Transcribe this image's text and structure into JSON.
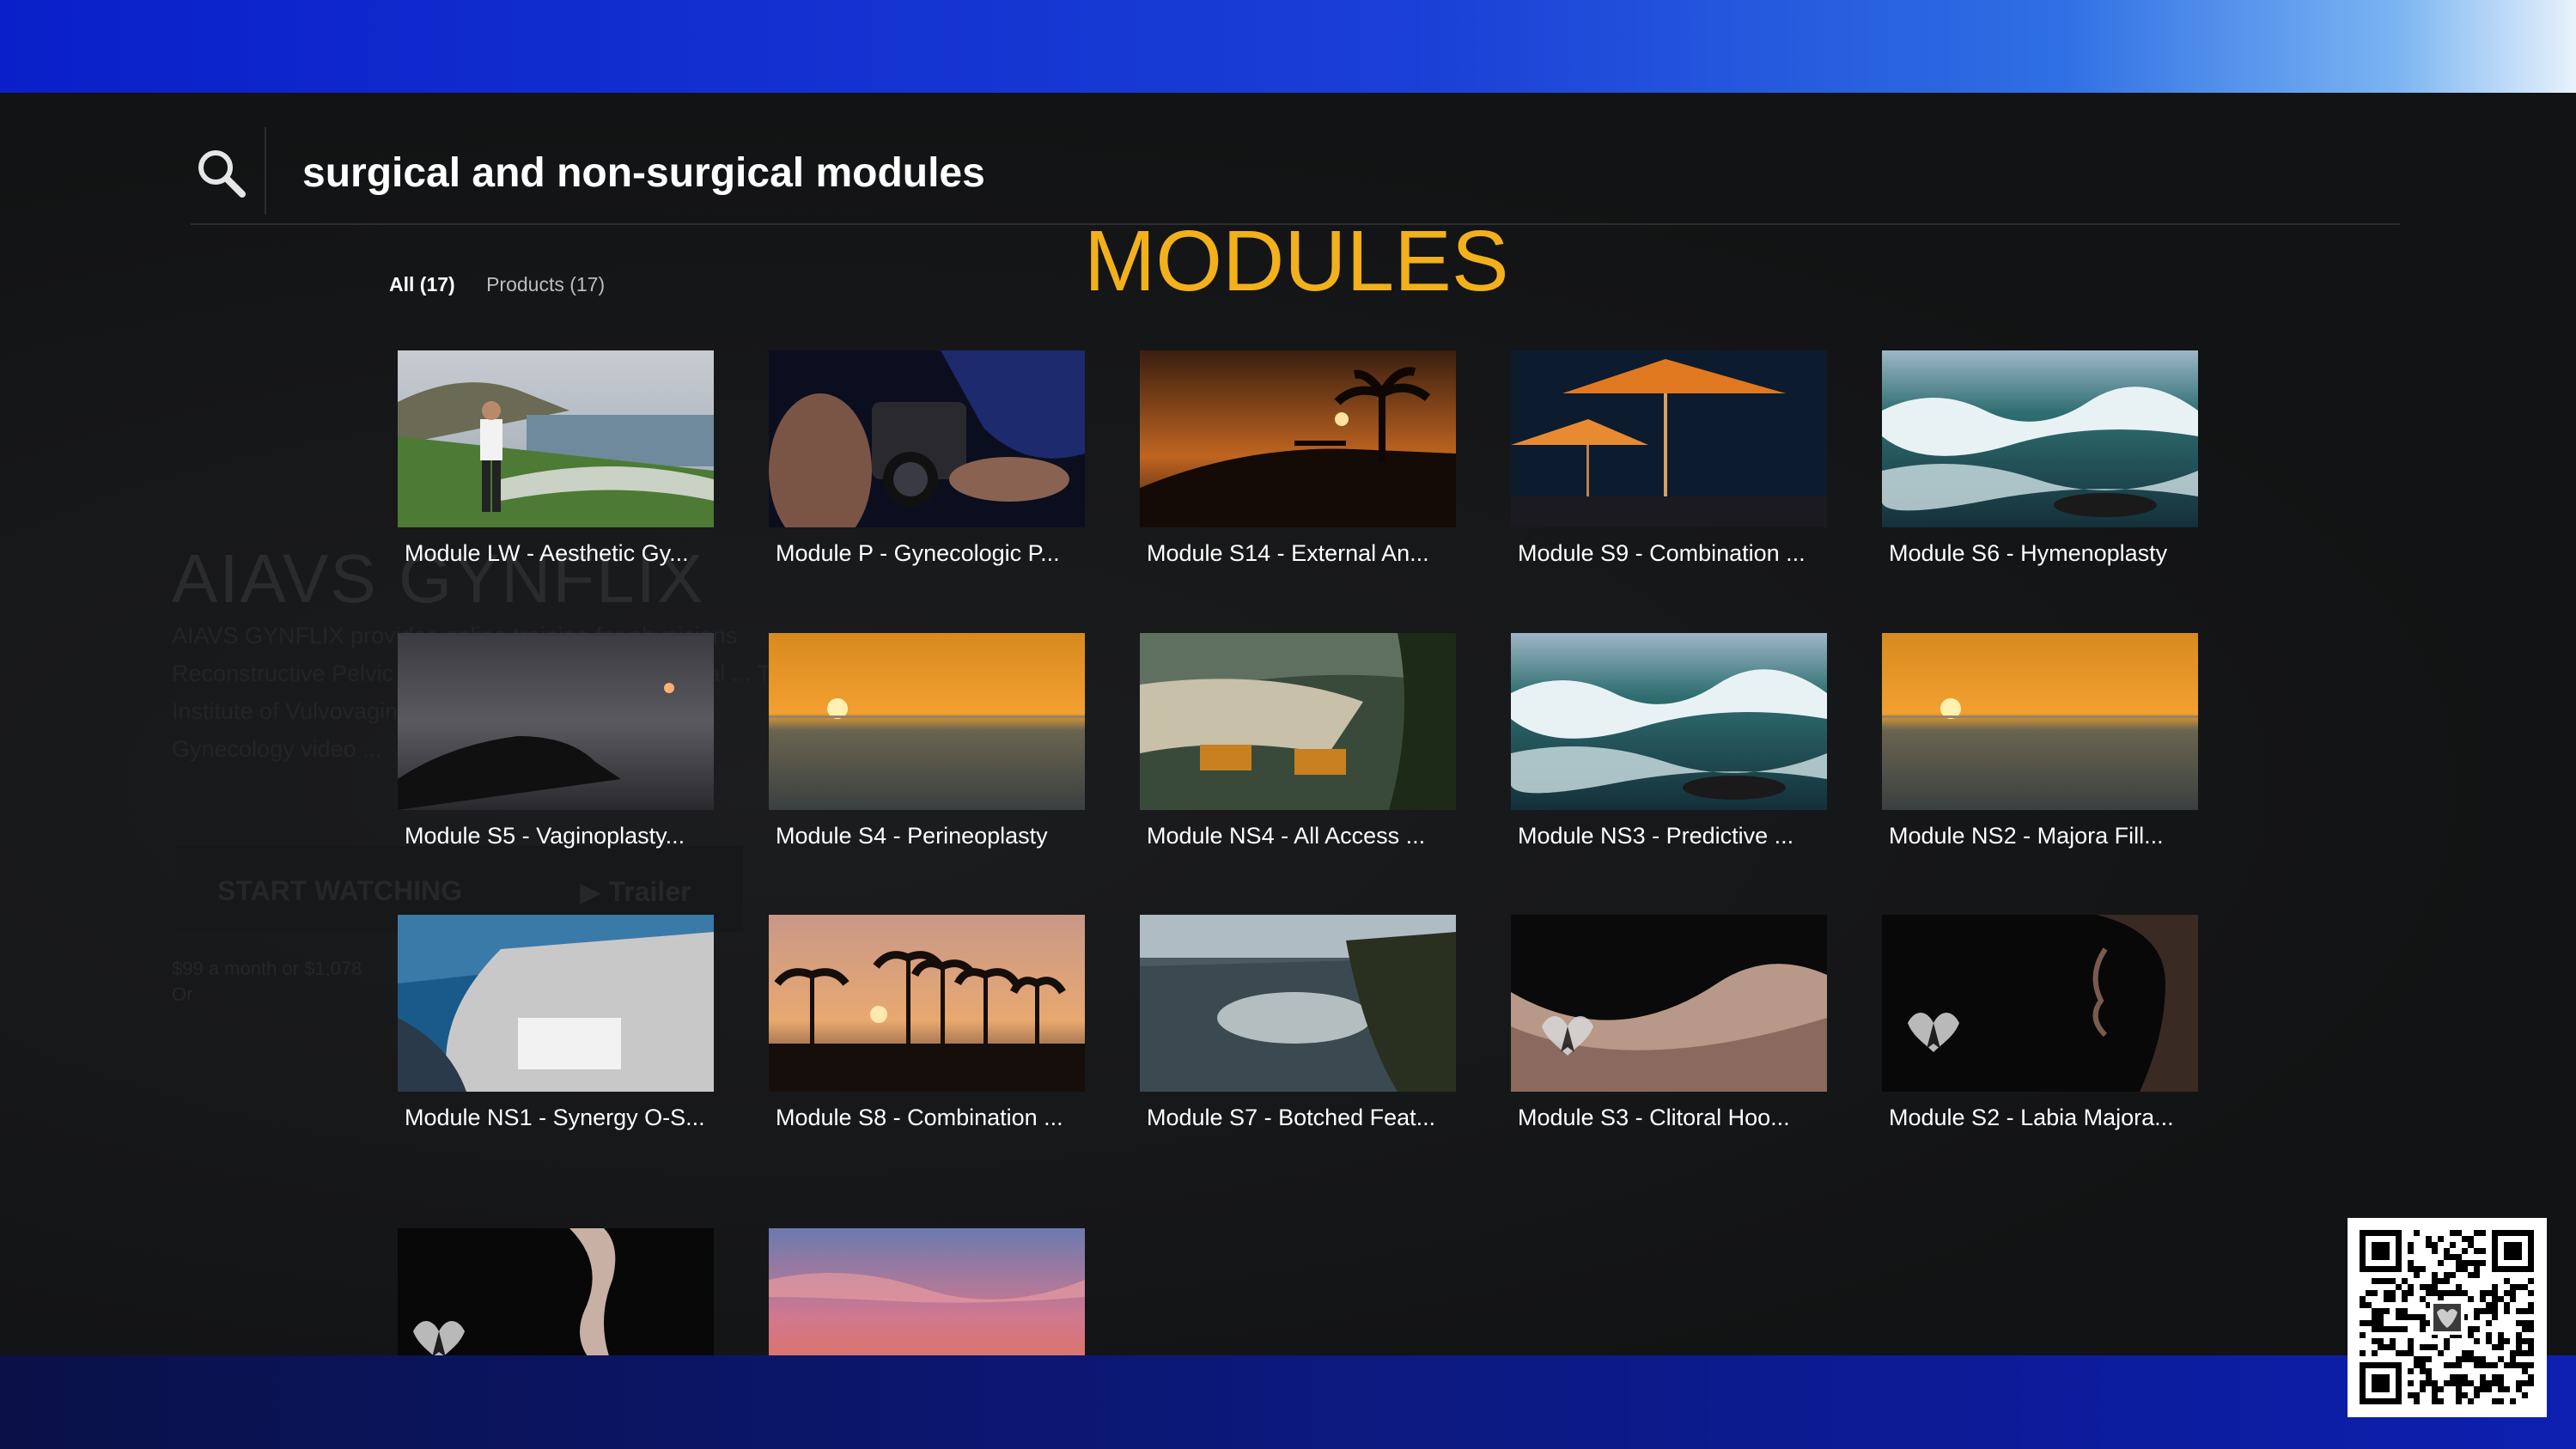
{
  "search": {
    "query": "surgical and non-surgical modules"
  },
  "heading": "MODULES",
  "filters": {
    "all": "All (17)",
    "products": "Products (17)"
  },
  "background": {
    "title": "AIAVS GYNFLIX",
    "description": [
      "AIAVS GYNFLIX provides online training for physicians",
      "Reconstructive Pelvic Surgery ... Alinsod Vulvovaginal ... This",
      "Institute of Vulvovaginal ... provides ... set of",
      "Gynecology video ..."
    ],
    "start_button": "START WATCHING",
    "trailer_button": "Trailer",
    "price_line": "$99 a month or $1,078",
    "price_or": "Or"
  },
  "modules": [
    {
      "title": "Module LW - Aesthetic Gy...",
      "scene": "coast-man"
    },
    {
      "title": "Module P - Gynecologic P...",
      "scene": "camera"
    },
    {
      "title": "Module S14 - External An...",
      "scene": "palm-sunset"
    },
    {
      "title": "Module S9 - Combination ...",
      "scene": "umbrellas"
    },
    {
      "title": "Module S6 - Hymenoplasty",
      "scene": "waves"
    },
    {
      "title": "Module S5 - Vaginoplasty...",
      "scene": "rock-sunset"
    },
    {
      "title": "Module S4 - Perineoplasty",
      "scene": "ocean-sunset"
    },
    {
      "title": "Module NS4 - All Access ...",
      "scene": "beach-chairs"
    },
    {
      "title": "Module NS3 - Predictive ...",
      "scene": "waves"
    },
    {
      "title": "Module NS2 - Majora Fill...",
      "scene": "ocean-sunset"
    },
    {
      "title": "Module NS1 - Synergy O-S...",
      "scene": "city-coast"
    },
    {
      "title": "Module S8 - Combination ...",
      "scene": "palms-pink"
    },
    {
      "title": "Module S7 - Botched Feat...",
      "scene": "cove"
    },
    {
      "title": "Module S3 - Clitoral Hoo...",
      "scene": "body-logo"
    },
    {
      "title": "Module S2 - Labia Majora...",
      "scene": "profile-logo"
    },
    {
      "title": "",
      "scene": "hand-logo"
    },
    {
      "title": "",
      "scene": "pink-sky"
    }
  ],
  "colors": {
    "accent": "#f2b01b",
    "band_blue": "#0d1fb0",
    "background": "#141516"
  },
  "icons": {
    "search": "search-icon",
    "qr": "qr-code"
  }
}
